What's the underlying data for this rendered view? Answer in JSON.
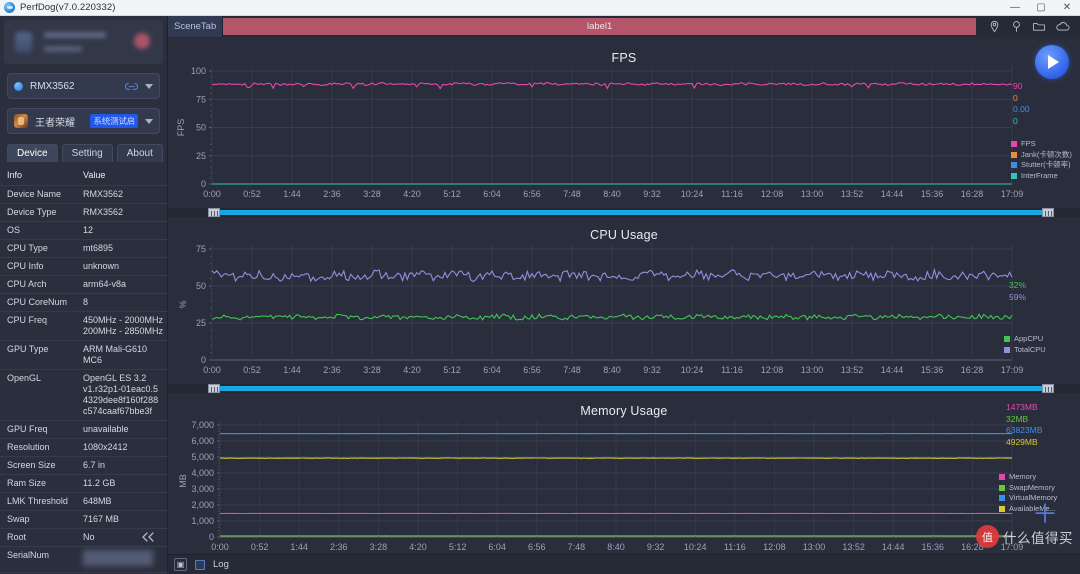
{
  "window": {
    "title": "PerfDog(v7.0.220332)",
    "minimize": "—",
    "maximize": "▢",
    "close": "✕"
  },
  "sidebar": {
    "device_select": {
      "label": "RMX3562",
      "icon": "device-dot-icon",
      "link_icon": "link-icon"
    },
    "app_select": {
      "label": "王者荣耀",
      "badge": "系统测试启",
      "icon": "game-icon"
    },
    "tabs": [
      {
        "label": "Device",
        "active": true
      },
      {
        "label": "Setting",
        "active": false
      },
      {
        "label": "About",
        "active": false
      }
    ],
    "table": {
      "headers": [
        "Info",
        "Value"
      ],
      "rows": [
        [
          "Device Name",
          "RMX3562"
        ],
        [
          "Device Type",
          "RMX3562"
        ],
        [
          "OS",
          "12"
        ],
        [
          "CPU Type",
          "mt6895"
        ],
        [
          "CPU Info",
          "unknown"
        ],
        [
          "CPU Arch",
          "arm64-v8a"
        ],
        [
          "CPU CoreNum",
          "8"
        ],
        [
          "CPU Freq",
          "450MHz - 2000MHz\n200MHz - 2850MHz"
        ],
        [
          "GPU Type",
          "ARM Mali-G610 MC6"
        ],
        [
          "OpenGL",
          "OpenGL ES 3.2 v1.r32p1-01eac0.5 4329dee8f160f288 c574caaf67bbe3f"
        ],
        [
          "GPU Freq",
          "unavailable"
        ],
        [
          "Resolution",
          "1080x2412"
        ],
        [
          "Screen Size",
          "6.7 in"
        ],
        [
          "Ram Size",
          "11.2 GB"
        ],
        [
          "LMK Threshold",
          "648MB"
        ],
        [
          "Swap",
          "7167 MB"
        ],
        [
          "Root",
          "No"
        ],
        [
          "SerialNum",
          ""
        ]
      ]
    },
    "collapse_icon": "chevron-double-left-icon"
  },
  "scenebar": {
    "tab_label": "SceneTab",
    "label_bar": "label1",
    "icons": [
      "location-pin-icon",
      "marker-pin-icon",
      "folder-icon",
      "cloud-icon"
    ]
  },
  "toolbar": {
    "play_icon": "play-icon",
    "add_icon": "plus-icon"
  },
  "statusbar": {
    "export_icon": "export-icon",
    "log_checkbox_label": "Log",
    "log_checked": false
  },
  "watermark": {
    "badge": "值",
    "text": "什么值得买"
  },
  "chart_data": [
    {
      "type": "line",
      "title": "FPS",
      "ylabel": "FPS",
      "xlabel": "",
      "ylim": [
        0,
        100
      ],
      "yticks": [
        0,
        25,
        50,
        75,
        100
      ],
      "xticks": [
        "0:00",
        "0:52",
        "1:44",
        "2:36",
        "3:28",
        "4:20",
        "5:12",
        "6:04",
        "6:56",
        "7:48",
        "8:40",
        "9:32",
        "10:24",
        "11:16",
        "12:08",
        "13:00",
        "13:52",
        "14:44",
        "15:36",
        "16:28",
        "17:09"
      ],
      "grid": true,
      "legend_position": "right",
      "series": [
        {
          "name": "FPS",
          "color": "#e845b0",
          "current": "90",
          "mean_level": 88.5,
          "noise": 2.0
        },
        {
          "name": "Jank(卡顿次数)",
          "color": "#e8913a",
          "current": "0",
          "mean_level": 0,
          "noise": 0
        },
        {
          "name": "Stutter(卡顿率)",
          "color": "#3f8fe0",
          "current": "0.00",
          "mean_level": 0,
          "noise": 0
        },
        {
          "name": "InterFrame",
          "color": "#31c3b8",
          "current": "0",
          "mean_level": 0,
          "noise": 0
        }
      ]
    },
    {
      "type": "line",
      "title": "CPU Usage",
      "ylabel": "%",
      "xlabel": "",
      "ylim": [
        0,
        75
      ],
      "yticks": [
        0,
        25,
        50,
        75
      ],
      "xticks": [
        "0:00",
        "0:52",
        "1:44",
        "2:36",
        "3:28",
        "4:20",
        "5:12",
        "6:04",
        "6:56",
        "7:48",
        "8:40",
        "9:32",
        "10:24",
        "11:16",
        "12:08",
        "13:00",
        "13:52",
        "14:44",
        "15:36",
        "16:28",
        "17:09"
      ],
      "grid": true,
      "legend_position": "right",
      "series": [
        {
          "name": "AppCPU",
          "color": "#41c552",
          "current": "32%",
          "mean_level": 29.0,
          "noise": 3.0
        },
        {
          "name": "TotalCPU",
          "color": "#8f8fe0",
          "current": "59%",
          "mean_level": 57.0,
          "noise": 6.0
        }
      ]
    },
    {
      "type": "line",
      "title": "Memory Usage",
      "ylabel": "MB",
      "xlabel": "",
      "ylim": [
        0,
        7000
      ],
      "yticks": [
        0,
        1000,
        2000,
        3000,
        4000,
        5000,
        6000,
        7000
      ],
      "yticklabels": [
        "0",
        "1,000",
        "2,000",
        "3,000",
        "4,000",
        "5,000",
        "6,000",
        "7,000"
      ],
      "xticks": [
        "0:00",
        "0:52",
        "1:44",
        "2:36",
        "3:28",
        "4:20",
        "5:12",
        "6:04",
        "6:56",
        "7:48",
        "8:40",
        "9:32",
        "10:24",
        "11:16",
        "12:08",
        "13:00",
        "13:52",
        "14:44",
        "15:36",
        "16:28",
        "17:09"
      ],
      "grid": true,
      "legend_position": "right",
      "series": [
        {
          "name": "Memory",
          "color": "#e845b0",
          "current": "1473MB",
          "mean_level": 1473,
          "noise": 8
        },
        {
          "name": "SwapMemory",
          "color": "#63c83c",
          "current": "32MB",
          "mean_level": 70,
          "noise": 3
        },
        {
          "name": "VirtualMemory",
          "color": "#3f8fe0",
          "current": "63823MB",
          "mean_level": 6460,
          "noise": 10
        },
        {
          "name": "AvailableMe...",
          "color": "#d6cb34",
          "current": "4929MB",
          "mean_level": 4929,
          "noise": 25
        }
      ]
    }
  ]
}
